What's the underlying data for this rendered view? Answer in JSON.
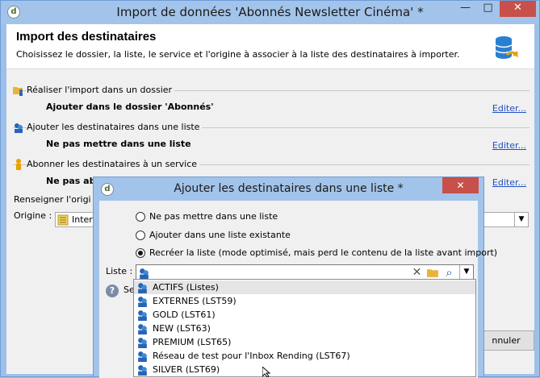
{
  "main_window": {
    "title": "Import de données 'Abonnés Newsletter Cinéma' *",
    "app_icon_glyph": "d",
    "minimize_glyph": "—",
    "maximize_glyph": "□",
    "close_glyph": "✕"
  },
  "header": {
    "title": "Import des destinataires",
    "subtitle": "Choisissez le dossier, la liste, le service et l'origine à associer à la liste des destinataires à importer."
  },
  "sections": [
    {
      "label": "Réaliser l'import dans un dossier",
      "value": "Ajouter dans le dossier 'Abonnés'",
      "link": "Editer...",
      "icon": "folder-person-icon"
    },
    {
      "label": "Ajouter les destinataires dans une liste",
      "value": "Ne pas mettre dans une liste",
      "link": "Editer...",
      "icon": "list-people-icon"
    },
    {
      "label": "Abonner les destinataires à un service",
      "value": "Ne pas abo",
      "link": "Editer...",
      "icon": "service-person-icon"
    }
  ],
  "origin": {
    "section_label": "Renseigner l'origi",
    "label": "Origine :",
    "value": "Inter",
    "arrow_glyph": "▼"
  },
  "bottom_button": {
    "label": "nnuler"
  },
  "dialog": {
    "title": "Ajouter les destinataires dans une liste *",
    "app_icon_glyph": "d",
    "close_glyph": "✕",
    "options": [
      {
        "label": "Ne pas mettre dans une liste",
        "checked": false
      },
      {
        "label": "Ajouter dans une liste existante",
        "checked": false
      },
      {
        "label": "Recréer la liste (mode optimisé, mais perd le contenu de la liste avant import)",
        "checked": true
      }
    ],
    "liste_label": "Liste :",
    "clear_glyph": "✕",
    "search_glyph": "⌕",
    "arrow_glyph": "▼",
    "help_glyph": "?",
    "help_text": "Se"
  },
  "dropdown": {
    "items": [
      {
        "label": "ACTIFS (Listes)",
        "selected": true
      },
      {
        "label": "EXTERNES (LST59)",
        "selected": false
      },
      {
        "label": "GOLD (LST61)",
        "selected": false
      },
      {
        "label": "NEW (LST63)",
        "selected": false
      },
      {
        "label": "PREMIUM (LST65)",
        "selected": false
      },
      {
        "label": "Réseau de test pour l'Inbox Rending (LST67)",
        "selected": false
      },
      {
        "label": "SILVER (LST69)",
        "selected": false
      }
    ]
  },
  "colors": {
    "titlebar": "#a3c4ea",
    "close_red": "#c7504b",
    "link_blue": "#1d4fc4"
  }
}
